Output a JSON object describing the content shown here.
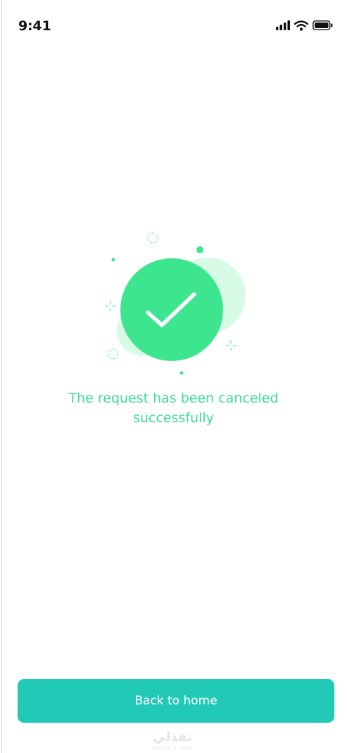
{
  "status_bar": {
    "time": "9:41",
    "icons": [
      "cellular-signal-icon",
      "wifi-icon",
      "battery-icon"
    ]
  },
  "illustration": {
    "icon": "checkmark-icon",
    "colors": {
      "main_circle": "#3de68e",
      "back_circle": "#d7fbe7",
      "accent": "#3de68e",
      "checkmark": "#ffffff"
    }
  },
  "message": {
    "text": "The request has been canceled successfully",
    "color": "#3ddc97"
  },
  "actions": {
    "back_home_label": "Back to home",
    "button_color": "#21c9b6"
  },
  "watermark": {
    "text": "نفذلي",
    "subtext": "nafezly.com"
  }
}
